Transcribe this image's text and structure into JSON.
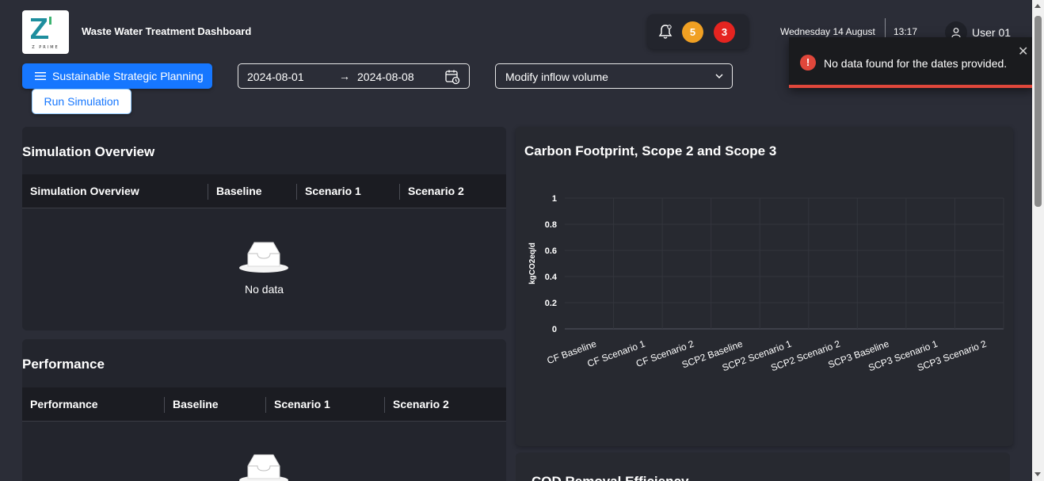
{
  "header": {
    "logo_text": "Z PRIME",
    "title": "Waste Water Treatment Dashboard",
    "notifications": {
      "warning_count": "5",
      "alert_count": "3"
    },
    "date": "Wednesday 14 August",
    "time": "13:17",
    "user": "User 01"
  },
  "toolbar": {
    "planning_label": "Sustainable Strategic Planning",
    "run_label": "Run Simulation",
    "date_start": "2024-08-01",
    "date_arrow": "→",
    "date_end": "2024-08-08",
    "inflow_value": "Modify inflow volume"
  },
  "toast": {
    "message": "No data found for the dates provided.",
    "close": "✕",
    "icon": "!"
  },
  "simulation": {
    "title": "Simulation Overview",
    "columns": [
      "Simulation Overview",
      "Baseline",
      "Scenario 1",
      "Scenario 2"
    ],
    "empty_text": "No data"
  },
  "performance": {
    "title": "Performance",
    "columns": [
      "Performance",
      "Baseline",
      "Scenario 1",
      "Scenario 2"
    ]
  },
  "cod_panel": {
    "title": "COD Removal Efficiency"
  },
  "chart_data": {
    "type": "bar",
    "title": "Carbon Footprint, Scope 2 and Scope 3",
    "xlabel": "",
    "ylabel": "kgCO2eq/d",
    "categories": [
      "CF Baseline",
      "CF Scenario 1",
      "CF Scenario 2",
      "SCP2 Baseline",
      "SCP2 Scenario 1",
      "SCP2 Scenario 2",
      "SCP3 Baseline",
      "SCP3 Scenario 1",
      "SCP3 Scenario 2"
    ],
    "values": [],
    "ylim": [
      0,
      1
    ],
    "yticks": [
      "0",
      "0.2",
      "0.4",
      "0.6",
      "0.8",
      "1"
    ],
    "grid": true
  },
  "colors": {
    "background": "#2b2d37",
    "panel": "#23252d",
    "accent": "#1677ff",
    "warning": "#f0a023",
    "danger": "#e52420"
  }
}
